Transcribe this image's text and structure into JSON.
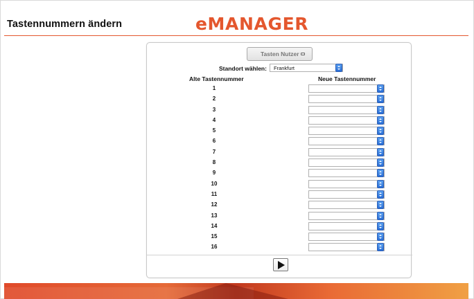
{
  "header": {
    "title": "Tastennummern ändern",
    "logo_text": "eMANAGER"
  },
  "panel": {
    "tab_button_label": "Tasten Nutzer",
    "location": {
      "label": "Standort wählen:",
      "selected": "Frankfurt"
    },
    "columns": {
      "old": "Alte Tastennummer",
      "new": "Neue Tastennummer"
    },
    "rows": [
      {
        "old": "1",
        "new": ""
      },
      {
        "old": "2",
        "new": ""
      },
      {
        "old": "3",
        "new": ""
      },
      {
        "old": "4",
        "new": ""
      },
      {
        "old": "5",
        "new": ""
      },
      {
        "old": "6",
        "new": ""
      },
      {
        "old": "7",
        "new": ""
      },
      {
        "old": "8",
        "new": ""
      },
      {
        "old": "9",
        "new": ""
      },
      {
        "old": "10",
        "new": ""
      },
      {
        "old": "11",
        "new": ""
      },
      {
        "old": "12",
        "new": ""
      },
      {
        "old": "13",
        "new": ""
      },
      {
        "old": "14",
        "new": ""
      },
      {
        "old": "15",
        "new": ""
      },
      {
        "old": "16",
        "new": ""
      }
    ],
    "submit_icon": "play-icon"
  },
  "colors": {
    "brand": "#e4572e",
    "stepper": "#2a6fd6"
  }
}
